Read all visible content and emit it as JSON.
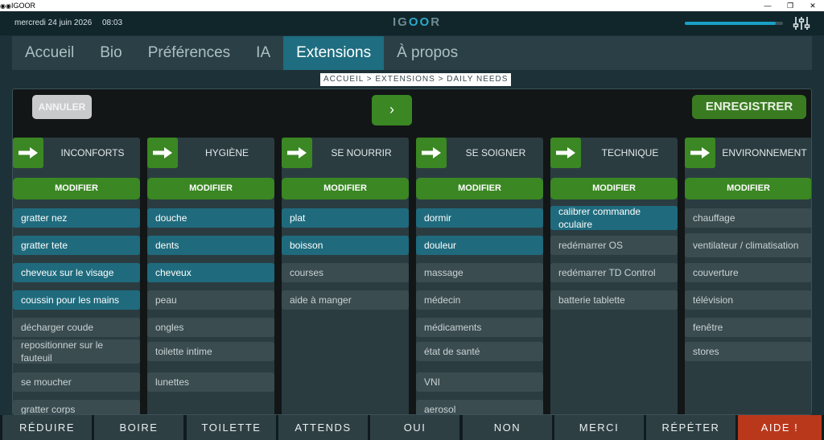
{
  "window": {
    "title": "IGOOR"
  },
  "header": {
    "date": "mercredi 24 juin 2026",
    "time": "08:03",
    "brand_left": "IG",
    "brand_mid": "OO",
    "brand_right": "R",
    "volume": 0.93
  },
  "tabs": [
    "Accueil",
    "Bio",
    "Préférences",
    "IA",
    "Extensions",
    "À propos"
  ],
  "active_tab": "Extensions",
  "breadcrumb": "ACCUEIL > EXTENSIONS > DAILY NEEDS",
  "toolbar": {
    "cancel_label": "ANNULER",
    "next_label": "›",
    "save_label": "ENREGISTRER"
  },
  "modify_label": "MODIFIER",
  "columns": [
    {
      "title": "INCONFORTS",
      "items": [
        {
          "label": "gratter nez",
          "active": true
        },
        {
          "label": "gratter tete",
          "active": true
        },
        {
          "label": "cheveux sur le visage",
          "active": true
        },
        {
          "label": "coussin pour les mains",
          "active": true
        },
        {
          "label": "décharger coude",
          "active": false
        },
        {
          "label": "repositionner sur le fauteuil",
          "active": false
        },
        {
          "label": "se moucher",
          "active": false
        },
        {
          "label": "gratter corps",
          "active": false
        }
      ]
    },
    {
      "title": "HYGIÈNE",
      "items": [
        {
          "label": "douche",
          "active": true
        },
        {
          "label": "dents",
          "active": true
        },
        {
          "label": "cheveux",
          "active": true
        },
        {
          "label": "peau",
          "active": false
        },
        {
          "label": "ongles",
          "active": false
        },
        {
          "label": "toilette intime",
          "active": false
        },
        {
          "label": "lunettes",
          "active": false
        }
      ]
    },
    {
      "title": "SE NOURRIR",
      "items": [
        {
          "label": "plat",
          "active": true
        },
        {
          "label": "boisson",
          "active": true
        },
        {
          "label": "courses",
          "active": false
        },
        {
          "label": "aide à manger",
          "active": false
        }
      ]
    },
    {
      "title": "SE SOIGNER",
      "items": [
        {
          "label": "dormir",
          "active": true
        },
        {
          "label": "douleur",
          "active": true
        },
        {
          "label": "massage",
          "active": false
        },
        {
          "label": "médecin",
          "active": false
        },
        {
          "label": "médicaments",
          "active": false
        },
        {
          "label": "état de santé",
          "active": false
        },
        {
          "label": "VNI",
          "active": false
        },
        {
          "label": "aerosol",
          "active": false
        }
      ]
    },
    {
      "title": "TECHNIQUE",
      "items": [
        {
          "label": "calibrer commande oculaire",
          "active": true
        },
        {
          "label": "redémarrer OS",
          "active": false
        },
        {
          "label": "redémarrer TD Control",
          "active": false
        },
        {
          "label": "batterie tablette",
          "active": false
        }
      ]
    },
    {
      "title": "ENVIRONNEMENT",
      "items": [
        {
          "label": "chauffage",
          "active": false
        },
        {
          "label": "ventilateur / climatisation",
          "active": false
        },
        {
          "label": "couverture",
          "active": false
        },
        {
          "label": "télévision",
          "active": false
        },
        {
          "label": "fenêtre",
          "active": false
        },
        {
          "label": "stores",
          "active": false
        }
      ]
    }
  ],
  "phrases": [
    "RÉDUIRE",
    "BOIRE",
    "TOILETTE",
    "ATTENDS",
    "OUI",
    "NON",
    "MERCI",
    "RÉPÉTER",
    "AIDE !"
  ],
  "colors": {
    "accent_green": "#3a8723",
    "item_active": "#1f6b7d",
    "alert": "#b9381c",
    "tab_active": "#1e6d80"
  }
}
